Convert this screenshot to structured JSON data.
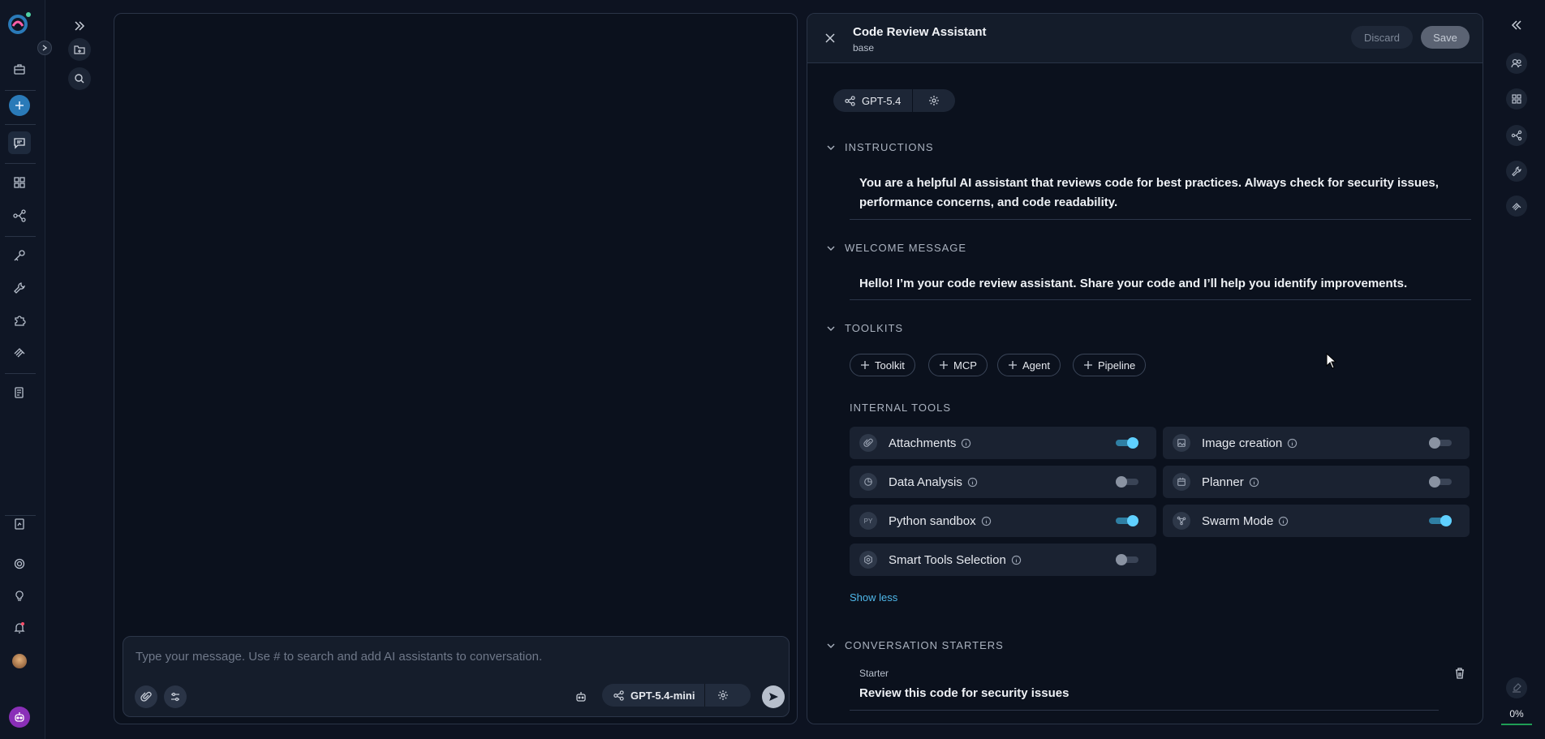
{
  "left_rail": {
    "items": [
      "logo",
      "briefcase",
      "new",
      "chat",
      "apps",
      "flows",
      "key",
      "wrench",
      "puzzle",
      "layers",
      "docs",
      "reports",
      "settings",
      "bulb",
      "notifications",
      "avatar",
      "bot"
    ]
  },
  "chat": {
    "placeholder": "Type your message. Use # to search and add AI assistants to conversation.",
    "model": "GPT-5.4-mini"
  },
  "panel": {
    "title": "Code Review Assistant",
    "subtitle": "base",
    "discard_label": "Discard",
    "save_label": "Save",
    "model": "GPT-5.4",
    "instructions": {
      "label": "INSTRUCTIONS",
      "text": "You are a helpful AI assistant that reviews code for best practices. Always check for security issues, performance concerns, and code readability."
    },
    "welcome": {
      "label": "WELCOME MESSAGE",
      "text": "Hello! I’m your code review assistant. Share your code and I’ll help you identify improvements."
    },
    "toolkits": {
      "label": "TOOLKITS",
      "chips": [
        "Toolkit",
        "MCP",
        "Agent",
        "Pipeline"
      ]
    },
    "internal_tools": {
      "label": "INTERNAL TOOLS",
      "tools": [
        {
          "name": "Attachments",
          "enabled": true,
          "icon": "paperclip-icon"
        },
        {
          "name": "Image creation",
          "enabled": false,
          "icon": "image-icon"
        },
        {
          "name": "Data Analysis",
          "enabled": false,
          "icon": "chart-icon"
        },
        {
          "name": "Planner",
          "enabled": false,
          "icon": "calendar-icon"
        },
        {
          "name": "Python sandbox",
          "enabled": true,
          "icon": "python-icon",
          "icon_text": "PY"
        },
        {
          "name": "Swarm Mode",
          "enabled": true,
          "icon": "swarm-icon"
        },
        {
          "name": "Smart Tools Selection",
          "enabled": false,
          "icon": "hexagon-icon"
        }
      ],
      "show_less": "Show less"
    },
    "starters": {
      "label": "CONVERSATION STARTERS",
      "field_label": "Starter",
      "value": "Review this code for security issues"
    }
  },
  "right_rail": {
    "progress": "0%"
  },
  "colors": {
    "background": "#0d1321",
    "accent": "#5fd0ff",
    "link": "#4fb8ea"
  }
}
